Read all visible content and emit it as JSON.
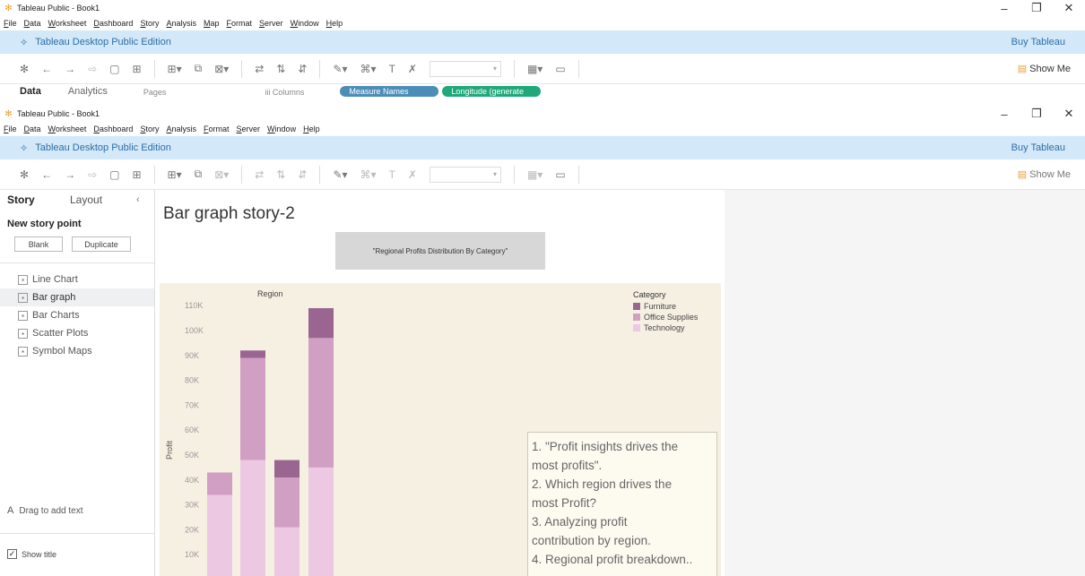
{
  "window_title": "Tableau Public - Book1",
  "menu": [
    "File",
    "Data",
    "Worksheet",
    "Dashboard",
    "Story",
    "Analysis",
    "Map",
    "Format",
    "Server",
    "Window",
    "Help"
  ],
  "banner": {
    "edition": "Tableau Desktop Public Edition",
    "buy": "Buy Tableau"
  },
  "toolbar": {
    "show_me": "Show Me"
  },
  "back_window": {
    "tabs": {
      "data": "Data",
      "analytics": "Analytics"
    },
    "shelves": {
      "pages": "Pages",
      "columns": "iii Columns"
    },
    "pills": [
      "Measure Names",
      "Longitude (generate"
    ]
  },
  "story_panel": {
    "tab_story": "Story",
    "tab_layout": "Layout",
    "new_story_point": "New story point",
    "blank": "Blank",
    "duplicate": "Duplicate",
    "sheets": [
      {
        "label": "Line Chart",
        "active": false
      },
      {
        "label": "Bar graph",
        "active": true
      },
      {
        "label": "Bar Charts",
        "active": false
      },
      {
        "label": "Scatter Plots",
        "active": false
      },
      {
        "label": "Symbol Maps",
        "active": false
      }
    ],
    "drag_text": "Drag to add text",
    "show_title": "Show title"
  },
  "story": {
    "title": "Bar graph story-2",
    "caption": "\"Regional Profits Distribution By Category\"",
    "annotation": [
      "1. \"Profit insights drives the",
      "most profits\".",
      "2. Which region drives the",
      "most Profit?",
      "3. Analyzing profit",
      "contribution by region.",
      "4. Regional profit breakdown.."
    ]
  },
  "colors": {
    "furniture": "#9a6590",
    "office_supplies": "#d19fc4",
    "technology": "#ecc8e2",
    "viz_bg": "#f6f0e3"
  },
  "chart_data": {
    "type": "bar",
    "stacked": true,
    "header": "Region",
    "ylabel": "Profit",
    "ylim": [
      0,
      115000
    ],
    "ticks": [
      "10K",
      "20K",
      "30K",
      "40K",
      "50K",
      "60K",
      "70K",
      "80K",
      "90K",
      "100K",
      "110K"
    ],
    "tick_values": [
      10000,
      20000,
      30000,
      40000,
      50000,
      60000,
      70000,
      80000,
      90000,
      100000,
      110000
    ],
    "legend_title": "Category",
    "series": [
      {
        "name": "Technology",
        "color": "#ecc8e2",
        "values": [
          34000,
          48000,
          21000,
          45000
        ]
      },
      {
        "name": "Office Supplies",
        "color": "#d19fc4",
        "values": [
          9000,
          41000,
          20000,
          52000
        ]
      },
      {
        "name": "Furniture",
        "color": "#9a6590",
        "values": [
          0,
          3000,
          7000,
          12000
        ]
      }
    ],
    "legend_order": [
      "Furniture",
      "Office Supplies",
      "Technology"
    ]
  }
}
